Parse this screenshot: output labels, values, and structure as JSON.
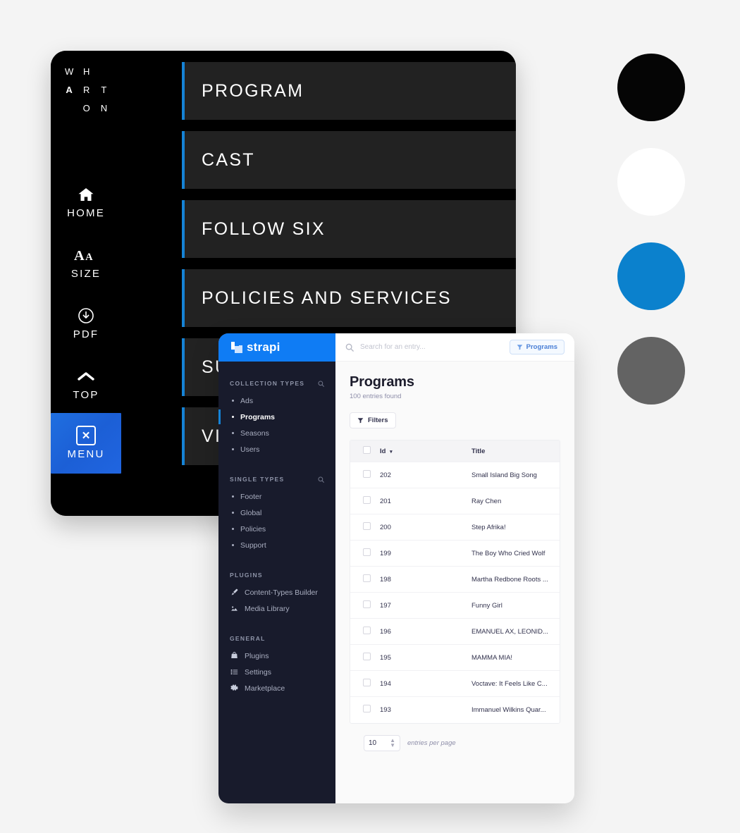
{
  "mobile_menu": {
    "logo": {
      "name": "wharton-logo",
      "cells": [
        "W",
        "H",
        "",
        "A",
        "R",
        "T",
        "",
        "O",
        "N"
      ]
    },
    "rail": [
      {
        "label": "HOME",
        "icon": "home-icon",
        "active": false
      },
      {
        "label": "SIZE",
        "icon": "text-size-icon",
        "active": false
      },
      {
        "label": "PDF",
        "icon": "download-circle-icon",
        "active": false
      },
      {
        "label": "TOP",
        "icon": "chevron-up-icon",
        "active": false
      },
      {
        "label": "MENU",
        "icon": "close-box-icon",
        "active": true
      }
    ],
    "items": [
      {
        "label": "PROGRAM"
      },
      {
        "label": "CAST"
      },
      {
        "label": "FOLLOW SIX"
      },
      {
        "label": "POLICIES AND SERVICES"
      },
      {
        "label": "SUPPORT"
      },
      {
        "label": "VIEW ALL"
      }
    ]
  },
  "strapi": {
    "brand": "strapi",
    "search": {
      "placeholder": "Search for an entry...",
      "value": "",
      "icon": "search-icon"
    },
    "header_filter_pill": {
      "label": "Programs",
      "icon": "filter-icon"
    },
    "sidebar": {
      "sections": [
        {
          "title": "COLLECTION TYPES",
          "search_icon": "search-icon",
          "items": [
            {
              "label": "Ads",
              "active": false
            },
            {
              "label": "Programs",
              "active": true
            },
            {
              "label": "Seasons",
              "active": false
            },
            {
              "label": "Users",
              "active": false
            }
          ]
        },
        {
          "title": "SINGLE TYPES",
          "search_icon": "search-icon",
          "items": [
            {
              "label": "Footer",
              "active": false
            },
            {
              "label": "Global",
              "active": false
            },
            {
              "label": "Policies",
              "active": false
            },
            {
              "label": "Support",
              "active": false
            }
          ]
        },
        {
          "title": "PLUGINS",
          "items": [
            {
              "label": "Content-Types Builder",
              "icon": "paintbrush-icon"
            },
            {
              "label": "Media Library",
              "icon": "photo-icon"
            }
          ]
        },
        {
          "title": "GENERAL",
          "items": [
            {
              "label": "Marketplace",
              "icon": "shopping-bag-icon"
            },
            {
              "label": "Plugins",
              "icon": "list-icon"
            },
            {
              "label": "Settings",
              "icon": "gear-icon"
            }
          ]
        }
      ]
    },
    "page": {
      "title": "Programs",
      "subtitle": "100 entries found",
      "filters_button": {
        "label": "Filters",
        "icon": "filter-icon"
      }
    },
    "table": {
      "columns": [
        "Id",
        "Title"
      ],
      "sort_indicator": "▾",
      "rows": [
        {
          "id": "202",
          "title": "Small Island Big Song"
        },
        {
          "id": "201",
          "title": "Ray Chen"
        },
        {
          "id": "200",
          "title": "Step Afrika!"
        },
        {
          "id": "199",
          "title": "The Boy Who Cried Wolf"
        },
        {
          "id": "198",
          "title": "Martha Redbone Roots ..."
        },
        {
          "id": "197",
          "title": "Funny Girl"
        },
        {
          "id": "196",
          "title": "EMANUEL AX, LEONID..."
        },
        {
          "id": "195",
          "title": "MAMMA MIA!"
        },
        {
          "id": "194",
          "title": "Voctave: It Feels Like C..."
        },
        {
          "id": "193",
          "title": "Immanuel Wilkins Quar..."
        }
      ]
    },
    "pagination": {
      "per_page_value": "10",
      "per_page_label": "entries per page"
    }
  },
  "swatches": [
    {
      "name": "swatch-black",
      "color": "#050505"
    },
    {
      "name": "swatch-white",
      "color": "#ffffff"
    },
    {
      "name": "swatch-blue",
      "color": "#0b81cd"
    },
    {
      "name": "swatch-gray",
      "color": "#636363"
    }
  ]
}
